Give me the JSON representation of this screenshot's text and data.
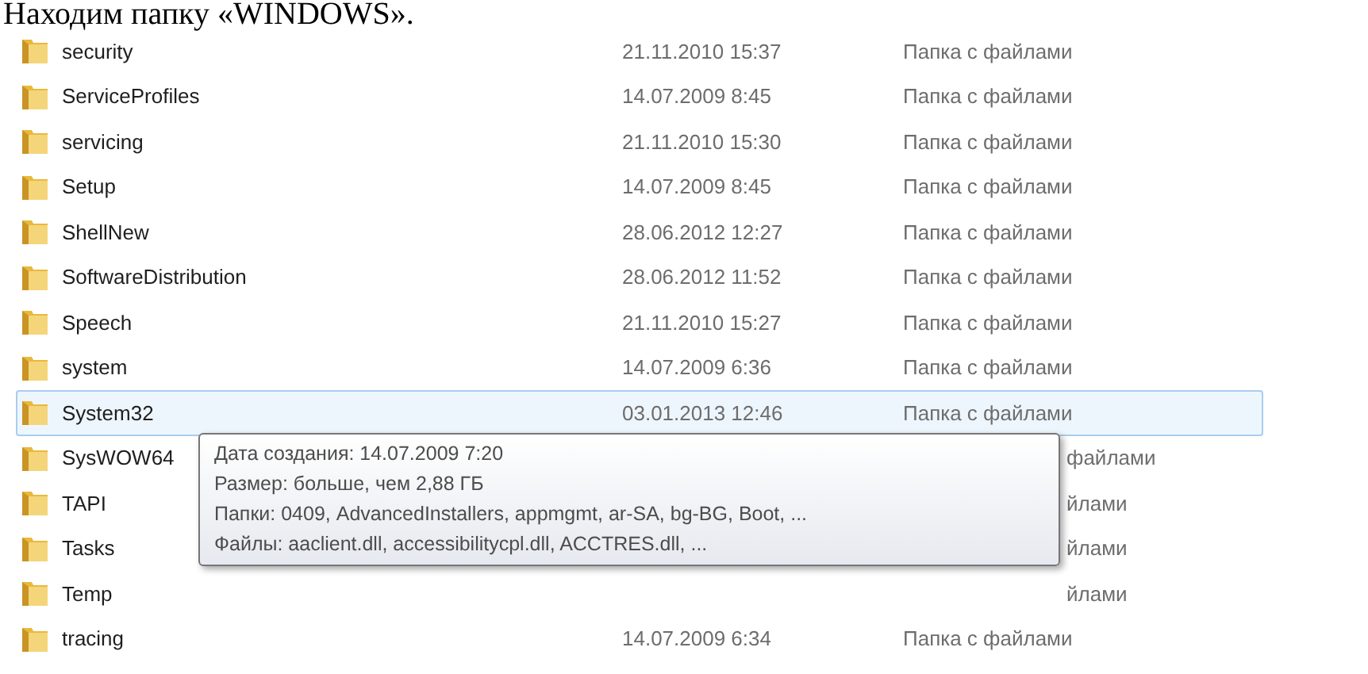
{
  "caption": "Находим папку «WINDOWS».",
  "rows": [
    {
      "name": "security",
      "date": "21.11.2010 15:37",
      "type": "Папка с файлами",
      "selected": false
    },
    {
      "name": "ServiceProfiles",
      "date": "14.07.2009 8:45",
      "type": "Папка с файлами",
      "selected": false
    },
    {
      "name": "servicing",
      "date": "21.11.2010 15:30",
      "type": "Папка с файлами",
      "selected": false
    },
    {
      "name": "Setup",
      "date": "14.07.2009 8:45",
      "type": "Папка с файлами",
      "selected": false
    },
    {
      "name": "ShellNew",
      "date": "28.06.2012 12:27",
      "type": "Папка с файлами",
      "selected": false
    },
    {
      "name": "SoftwareDistribution",
      "date": "28.06.2012 11:52",
      "type": "Папка с файлами",
      "selected": false
    },
    {
      "name": "Speech",
      "date": "21.11.2010 15:27",
      "type": "Папка с файлами",
      "selected": false
    },
    {
      "name": "system",
      "date": "14.07.2009 6:36",
      "type": "Папка с файлами",
      "selected": false
    },
    {
      "name": "System32",
      "date": "03.01.2013 12:46",
      "type": "Папка с файлами",
      "selected": true
    },
    {
      "name": "SysWOW64",
      "type_partial": "файлами",
      "selected": false
    },
    {
      "name": "TAPI",
      "type_partial": "йлами",
      "selected": false
    },
    {
      "name": "Tasks",
      "type_partial": "йлами",
      "selected": false
    },
    {
      "name": "Temp",
      "type_partial": "йлами",
      "selected": false
    },
    {
      "name": "tracing",
      "date": "14.07.2009 6:34",
      "type": "Папка с файлами",
      "selected": false
    }
  ],
  "tooltip": {
    "lines": [
      "Дата создания: 14.07.2009 7:20",
      "Размер: больше, чем 2,88 ГБ",
      "Папки: 0409, AdvancedInstallers, appmgmt, ar-SA, bg-BG, Boot, ...",
      "Файлы: aaclient.dll, accessibilitycpl.dll, ACCTRES.dll, ..."
    ]
  }
}
